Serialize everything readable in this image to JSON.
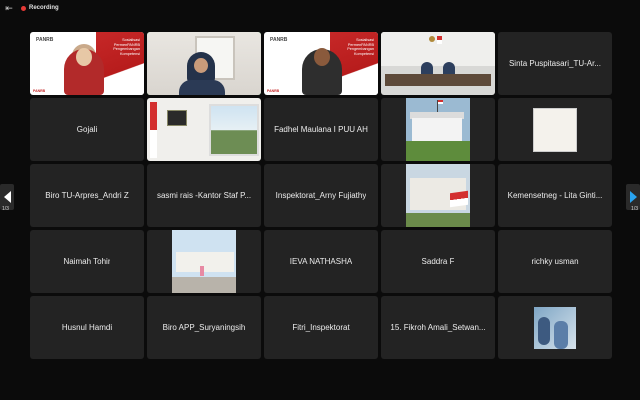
{
  "topbar": {
    "menu_icon": "sidebar-toggle-icon",
    "recording_label": "Recording"
  },
  "tiles": [
    {
      "type": "video",
      "style": "lecture-woman"
    },
    {
      "type": "video",
      "style": "office-woman",
      "active": true
    },
    {
      "type": "video",
      "style": "lecture-man"
    },
    {
      "type": "video",
      "style": "meeting-room"
    },
    {
      "type": "name",
      "name": "Sinta Puspitasari_TU-Ar..."
    },
    {
      "type": "name",
      "name": "Gojali"
    },
    {
      "type": "video",
      "style": "room-flag"
    },
    {
      "type": "name",
      "name": "Fadhel Maulana I PUU AH"
    },
    {
      "type": "image",
      "style": "palace"
    },
    {
      "type": "image",
      "style": "document"
    },
    {
      "type": "name",
      "name": "Biro TU-Arpres_Andri Z"
    },
    {
      "type": "name",
      "name": "sasmi rais -Kantor Staf P..."
    },
    {
      "type": "name",
      "name": "Inspektorat_Arny Fujiathy"
    },
    {
      "type": "image",
      "style": "palace-flag"
    },
    {
      "type": "name",
      "name": "Kemensetneg - Lita Ginti..."
    },
    {
      "type": "name",
      "name": "Naimah Tohir"
    },
    {
      "type": "image",
      "style": "palace-front"
    },
    {
      "type": "name",
      "name": "IEVA NATHASHA"
    },
    {
      "type": "name",
      "name": "Saddra F"
    },
    {
      "type": "name",
      "name": "richky usman"
    },
    {
      "type": "name",
      "name": "Husnul Hamdi"
    },
    {
      "type": "name",
      "name": "Biro APP_Suryaningsih"
    },
    {
      "type": "name",
      "name": "Fitri_Inspektorat"
    },
    {
      "type": "name",
      "name": "15. Fikroh Amali_Setwan..."
    },
    {
      "type": "image",
      "style": "people"
    }
  ],
  "lecture_slide": {
    "logo": "PANRB",
    "band_lines": [
      "Sosialisasi PermenPANRB",
      "Pengembangan",
      "Kompetensi"
    ],
    "footer": "PANRB"
  },
  "pagination": {
    "left": "1/3",
    "right": "1/3"
  },
  "colors": {
    "active_outline": "#3cc25a",
    "recording": "#e53935",
    "next_arrow": "#29a3f0"
  }
}
